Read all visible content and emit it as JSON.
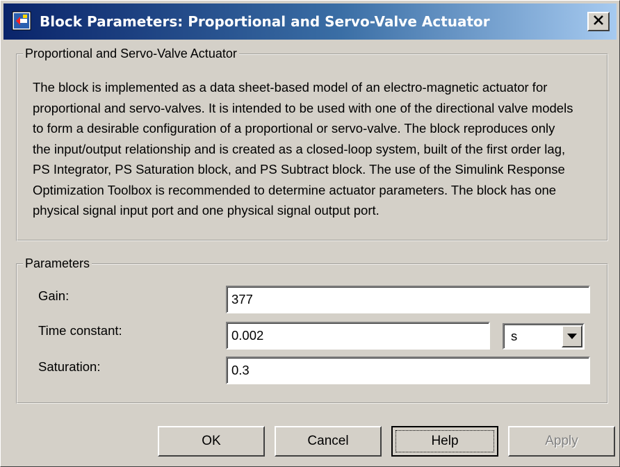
{
  "window": {
    "title": "Block Parameters: Proportional and Servo-Valve Actuator",
    "close_icon": "close-icon"
  },
  "description_group": {
    "legend": "Proportional and Servo-Valve Actuator",
    "text": "The block is implemented as a data sheet-based model of an electro-magnetic actuator for proportional and servo-valves. It is intended to be used with one of the directional valve models to form a desirable configuration of a proportional or servo-valve. The block reproduces only the input/output relationship and is created as a closed-loop system, built of the first order lag, PS Integrator, PS Saturation block, and PS Subtract block. The use of the Simulink Response Optimization Toolbox is recommended to determine actuator parameters. The block has one physical signal input port and one physical signal output port."
  },
  "parameters_group": {
    "legend": "Parameters",
    "gain": {
      "label": "Gain:",
      "value": "377"
    },
    "time_constant": {
      "label": "Time constant:",
      "value": "0.002",
      "unit": "s"
    },
    "saturation": {
      "label": "Saturation:",
      "value": "0.3"
    }
  },
  "buttons": {
    "ok": "OK",
    "cancel": "Cancel",
    "help": "Help",
    "apply": "Apply"
  },
  "colors": {
    "title_gradient_start": "#0a246a",
    "title_gradient_end": "#a6caf0",
    "dialog_face": "#d4d0c8"
  }
}
